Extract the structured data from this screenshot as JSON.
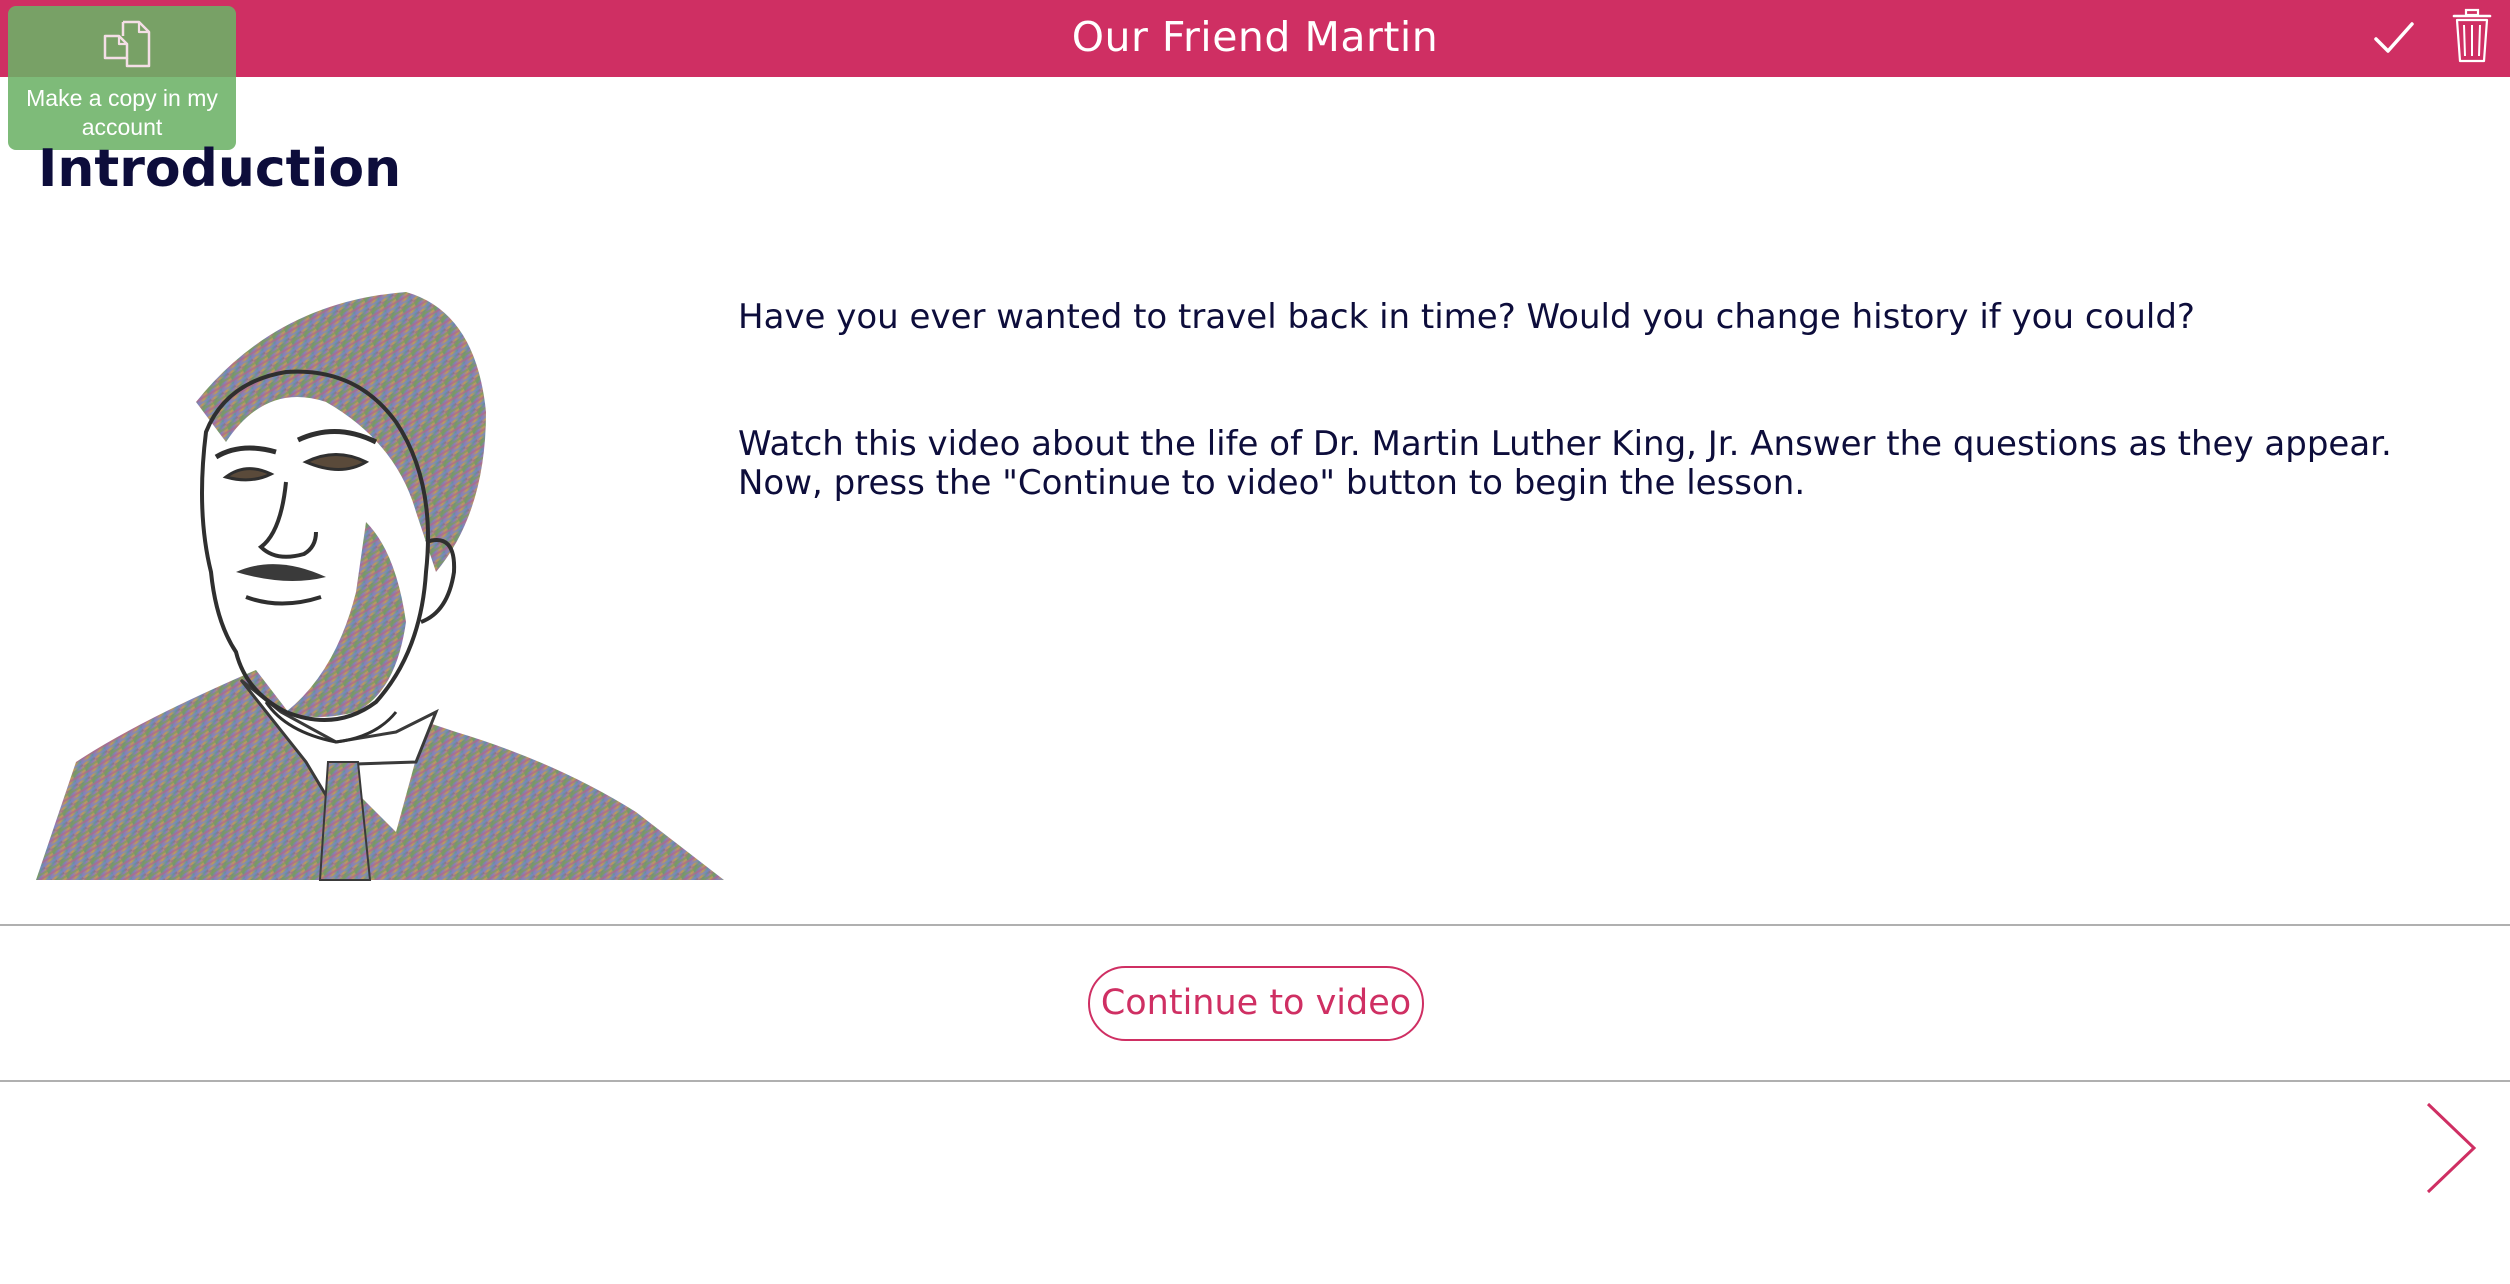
{
  "header": {
    "title": "Our Friend Martin",
    "accent_color": "#cf2f63",
    "done_icon": "checkmark-icon",
    "delete_icon": "trash-icon"
  },
  "copy_button": {
    "label": "Make a copy in my account",
    "icon": "copy-documents-icon",
    "color": "#6cb266"
  },
  "lesson": {
    "section_title": "Introduction",
    "paragraphs": [
      "Have you ever wanted to travel back in time? Would you change history if you could?",
      "Watch this video about the life of Dr. Martin Luther King, Jr. Answer the questions as they appear. Now, press the \"Continue to video\" button to begin the lesson."
    ],
    "image": "martin-luther-king-portrait"
  },
  "actions": {
    "continue_label": "Continue to video",
    "next_icon": "chevron-right-icon"
  }
}
